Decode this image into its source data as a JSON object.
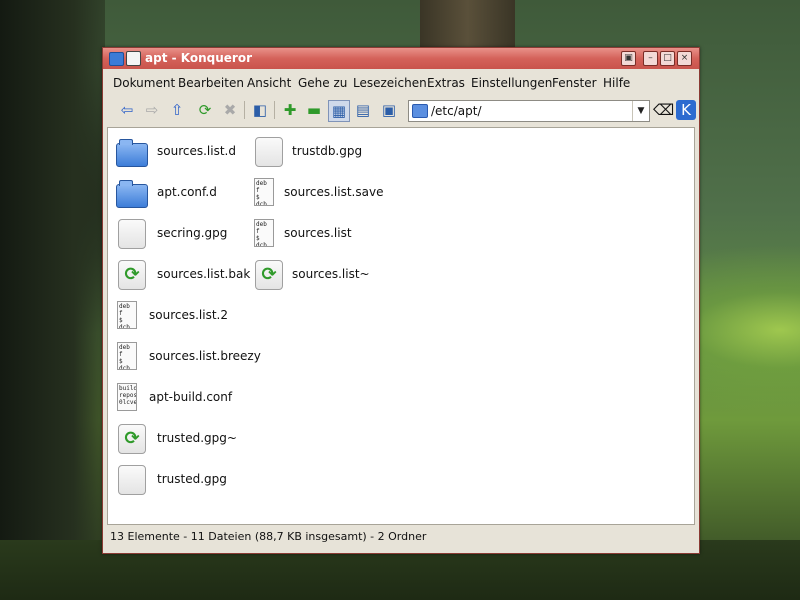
{
  "window": {
    "title": "apt - Konqueror"
  },
  "menu": {
    "items": [
      "Dokument",
      "Bearbeiten",
      "Ansicht",
      "Gehe zu",
      "Lesezeichen",
      "Extras",
      "Einstellungen",
      "Fenster",
      "Hilfe"
    ]
  },
  "toolbar": {
    "location": "/etc/apt/"
  },
  "files": [
    {
      "name": "sources.list.d",
      "icon": "folder-icon"
    },
    {
      "name": "apt.conf.d",
      "icon": "folder-icon"
    },
    {
      "name": "secring.gpg",
      "icon": "blank-file-icon"
    },
    {
      "name": "sources.list.bak",
      "icon": "backup-file-icon"
    },
    {
      "name": "sources.list.2",
      "icon": "text-file-icon"
    },
    {
      "name": "sources.list.breezy",
      "icon": "text-file-icon"
    },
    {
      "name": "apt-build.conf",
      "icon": "text-file-icon"
    },
    {
      "name": "trusted.gpg~",
      "icon": "backup-file-icon"
    },
    {
      "name": "trusted.gpg",
      "icon": "blank-file-icon"
    },
    {
      "name": "trustdb.gpg",
      "icon": "blank-file-icon"
    },
    {
      "name": "sources.list.save",
      "icon": "text-file-icon"
    },
    {
      "name": "sources.list",
      "icon": "text-file-icon"
    },
    {
      "name": "sources.list~",
      "icon": "backup-file-icon"
    }
  ],
  "icon_glyphs": {
    "deb_preview": "deb f\n$ dcb",
    "build_preview": "build\nrepos\n0lcve"
  },
  "status": {
    "text": "13 Elemente - 11 Dateien (88,7 KB insgesamt) - 2 Ordner"
  },
  "colors": {
    "titlebar": "#d4625a",
    "accent_green": "#2f9a2a",
    "folder_blue": "#3d7dd8"
  }
}
